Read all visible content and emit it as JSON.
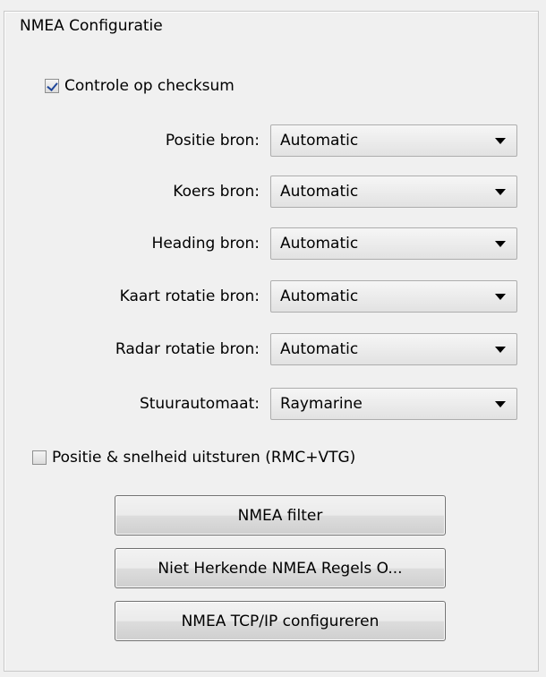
{
  "group": {
    "title": "NMEA Configuratie"
  },
  "checksum": {
    "label": "Controle op checksum",
    "checked": true
  },
  "fields": [
    {
      "label": "Positie bron:",
      "value": "Automatic"
    },
    {
      "label": "Koers bron:",
      "value": "Automatic"
    },
    {
      "label": "Heading bron:",
      "value": "Automatic"
    },
    {
      "label": "Kaart rotatie bron:",
      "value": "Automatic"
    },
    {
      "label": "Radar rotatie bron:",
      "value": "Automatic"
    },
    {
      "label": "Stuurautomaat:",
      "value": "Raymarine"
    }
  ],
  "output": {
    "label": "Positie & snelheid uitsturen (RMC+VTG)",
    "checked": false
  },
  "buttons": {
    "filter": "NMEA filter",
    "unrecognized": "Niet Herkende NMEA Regels O...",
    "tcpip": "NMEA TCP/IP configureren"
  },
  "icons": {
    "dropdown": "chevron-down-icon",
    "check": "checkmark-icon"
  },
  "colors": {
    "background": "#f0f0f0",
    "check": "#20479a",
    "border": "#adadad"
  }
}
